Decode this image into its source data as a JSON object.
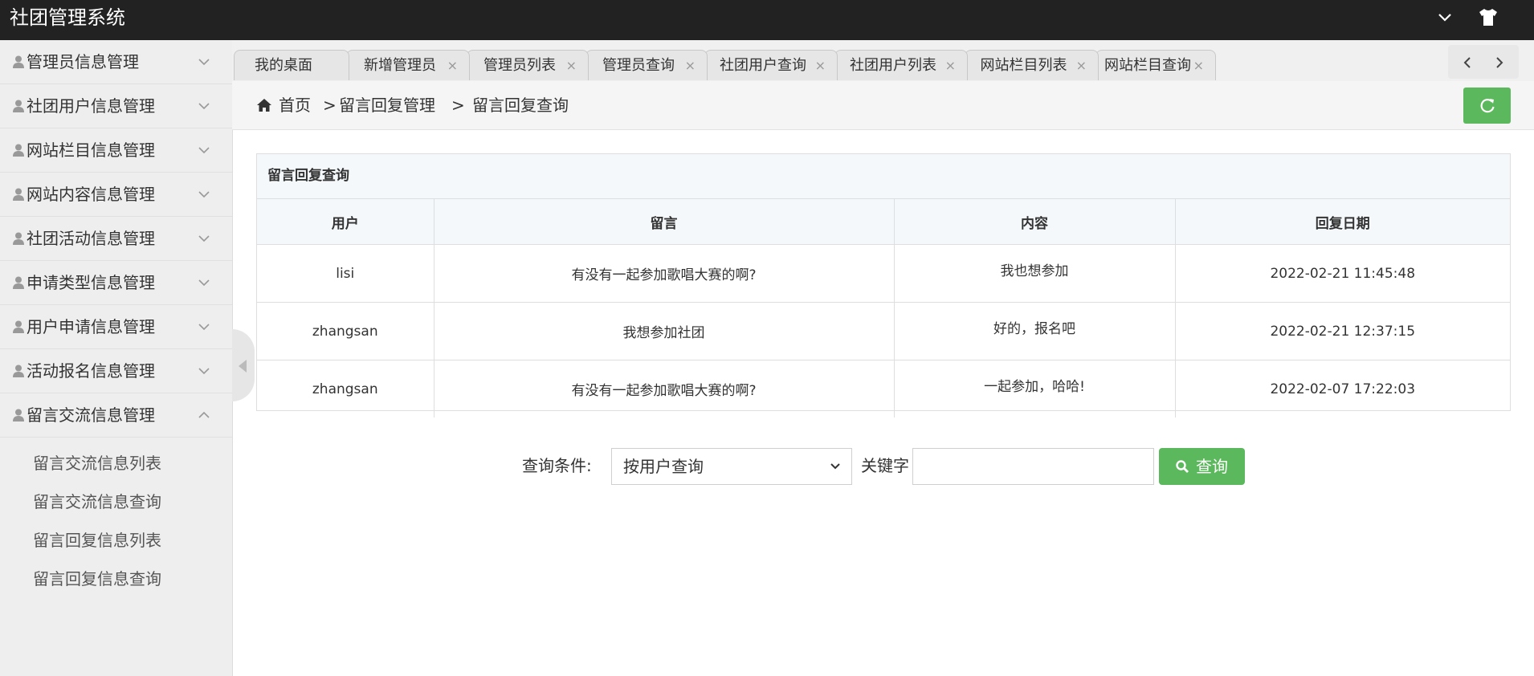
{
  "app": {
    "title": "社团管理系统"
  },
  "sidebar": {
    "items": [
      {
        "label": "管理员信息管理"
      },
      {
        "label": "社团用户信息管理"
      },
      {
        "label": "网站栏目信息管理"
      },
      {
        "label": "网站内容信息管理"
      },
      {
        "label": "社团活动信息管理"
      },
      {
        "label": "申请类型信息管理"
      },
      {
        "label": "用户申请信息管理"
      },
      {
        "label": "活动报名信息管理"
      },
      {
        "label": "留言交流信息管理"
      }
    ],
    "subitems": [
      {
        "label": "留言交流信息列表"
      },
      {
        "label": "留言交流信息查询"
      },
      {
        "label": "留言回复信息列表"
      },
      {
        "label": "留言回复信息查询"
      }
    ]
  },
  "tabs": [
    {
      "label": "我的桌面"
    },
    {
      "label": "新增管理员"
    },
    {
      "label": "管理员列表"
    },
    {
      "label": "管理员查询"
    },
    {
      "label": "社团用户查询"
    },
    {
      "label": "社团用户列表"
    },
    {
      "label": "网站栏目列表"
    },
    {
      "label": "网站栏目查询"
    }
  ],
  "tab_close_glyph": "×",
  "breadcrumb": {
    "home": "首页",
    "sep": ">",
    "level1": "留言回复管理",
    "level2": "留言回复查询"
  },
  "panel": {
    "title": "留言回复查询",
    "columns": [
      "用户",
      "留言",
      "内容",
      "回复日期"
    ],
    "rows": [
      {
        "user": "lisi",
        "message": "有没有一起参加歌唱大赛的啊?",
        "content": "我也想参加",
        "date": "2022-02-21 11:45:48"
      },
      {
        "user": "zhangsan",
        "message": "我想参加社团",
        "content": "好的，报名吧",
        "date": "2022-02-21 12:37:15"
      },
      {
        "user": "zhangsan",
        "message": "有没有一起参加歌唱大赛的啊?",
        "content": "一起参加，哈哈!",
        "date": "2022-02-07 17:22:03"
      }
    ]
  },
  "query": {
    "condition_label": "查询条件:",
    "condition_value": "按用户查询",
    "keyword_label": "关键字",
    "keyword_value": "",
    "button_label": "查询"
  },
  "colors": {
    "header_bg": "#222222",
    "accent_green": "#5cb85c",
    "sidebar_bg": "#eeeeee"
  },
  "icons": [
    "chevron-down-icon",
    "tshirt-icon",
    "user-icon",
    "chevron-up-icon",
    "home-icon",
    "refresh-icon",
    "search-icon",
    "arrow-left-icon",
    "arrow-right-icon",
    "caret-left-icon"
  ]
}
